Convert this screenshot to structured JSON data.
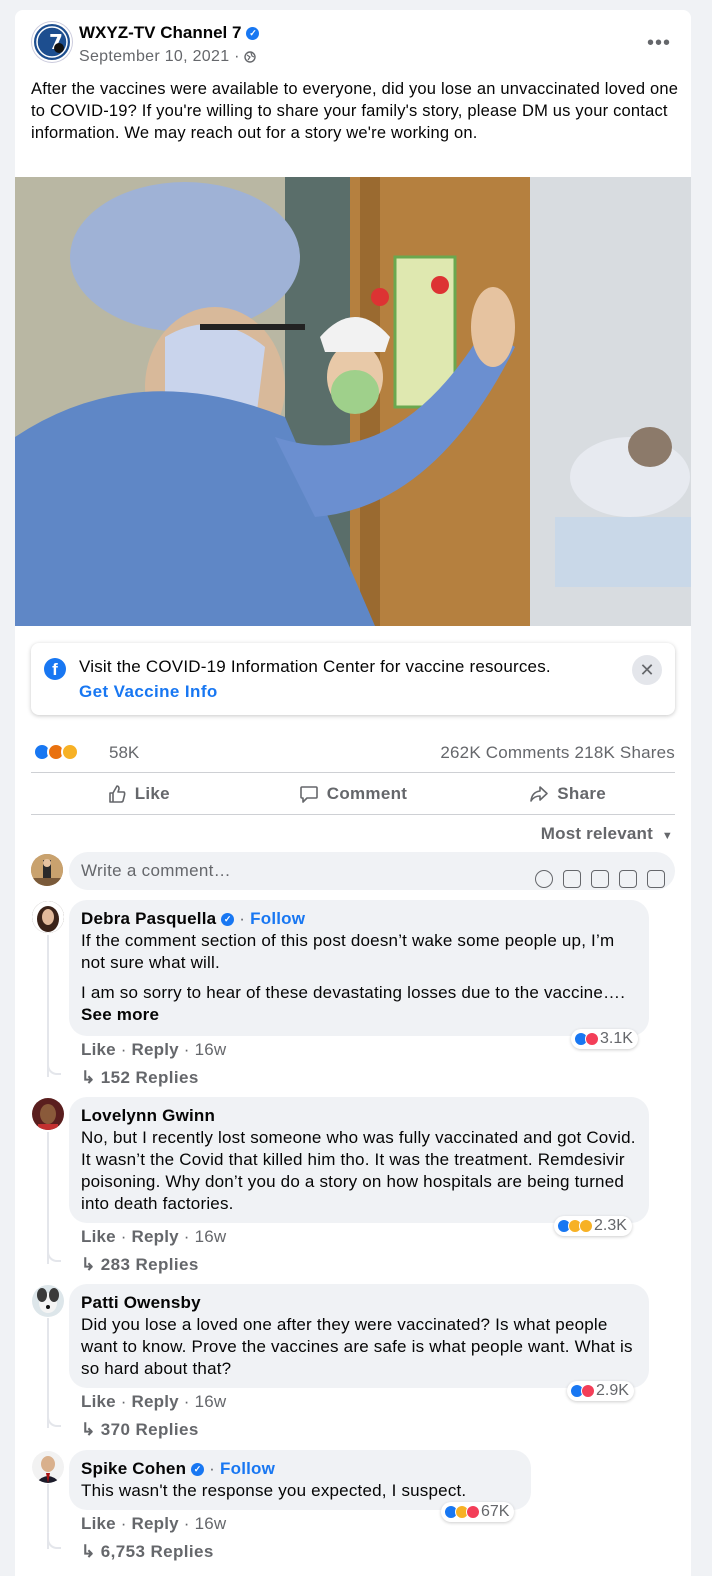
{
  "post": {
    "page_name": "WXYZ-TV Channel 7",
    "date": "September 10, 2021 ·",
    "text": "After the vaccines were available to everyone, did you lose an unvaccinated loved one to COVID-19? If you're willing to share your family's story, please DM us your contact information. We may reach out for a story we're working on.",
    "logo_text": "7"
  },
  "info_center": {
    "text": "Visit the COVID-19 Information Center for vaccine resources.",
    "link": "Get Vaccine Info"
  },
  "stats": {
    "reactions_count": "58K",
    "comments_shares": "262K Comments  218K Shares"
  },
  "actions": {
    "like": "Like",
    "comment": "Comment",
    "share": "Share"
  },
  "sort_label": "Most relevant",
  "comment_box": {
    "placeholder": "Write a comment…"
  },
  "comments": [
    {
      "author": "Debra Pasquella",
      "follow": "Follow",
      "paragraph1": "If the comment section of this post doesn’t wake some people up, I’m not sure what will.",
      "paragraph2": "I am so sorry to hear of these devastating losses due to the vaccine….",
      "see_more": "See more",
      "reactions": "3.1K",
      "like": "Like",
      "reply": "Reply",
      "age": "16w",
      "replies": "152 Replies"
    },
    {
      "author": "Lovelynn Gwinn",
      "text": "No, but I recently lost someone who was fully vaccinated and got Covid. It wasn’t the Covid that killed him tho. It was the treatment. Remdesivir poisoning. Why don’t you do a story on how hospitals are being turned into death factories.",
      "reactions": "2.3K",
      "like": "Like",
      "reply": "Reply",
      "age": "16w",
      "replies": "283 Replies"
    },
    {
      "author": "Patti Owensby",
      "text": "Did you lose a loved one after they were vaccinated? Is what people want to know. Prove the vaccines are safe is what people want. What is so hard about that?",
      "reactions": "2.9K",
      "like": "Like",
      "reply": "Reply",
      "age": "16w",
      "replies": "370 Replies"
    },
    {
      "author": "Spike Cohen",
      "follow": "Follow",
      "text": "This wasn't the response you expected, I suspect.",
      "reactions": "67K",
      "like": "Like",
      "reply": "Reply",
      "age": "16w",
      "replies": "6,753 Replies"
    }
  ],
  "colors": {
    "accent": "#1877f2",
    "secondary_text": "#65676b",
    "bubble_bg": "#f0f2f5"
  }
}
